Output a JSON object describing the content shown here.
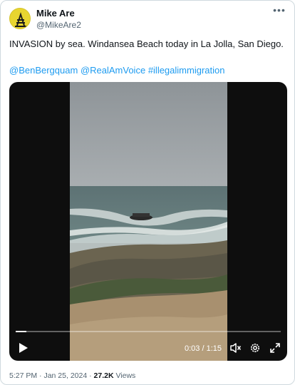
{
  "author": {
    "name": "Mike Are",
    "handle": "@MikeAre2"
  },
  "tweet": {
    "text": "INVASION by sea. Windansea Beach today in La Jolla, San Diego.",
    "mentions": [
      "@BenBergquam",
      "@RealAmVoice",
      "#illegalimmigration"
    ]
  },
  "video": {
    "current_time": "0:03",
    "separator": "/",
    "duration": "1:15",
    "progress": 0.04
  },
  "footer": {
    "time": "5:27 PM",
    "dot": "·",
    "date": "Jan 25, 2024",
    "dot2": "·",
    "views_count": "27.2K",
    "views_label": "Views"
  },
  "icons": {
    "more": "more-icon",
    "play": "play-icon",
    "mute": "mute-icon",
    "settings": "settings-icon",
    "fullscreen": "fullscreen-icon"
  },
  "colors": {
    "link": "#1d9bf0",
    "avatar_bg": "#e8d530",
    "secondary_text": "#536471"
  }
}
